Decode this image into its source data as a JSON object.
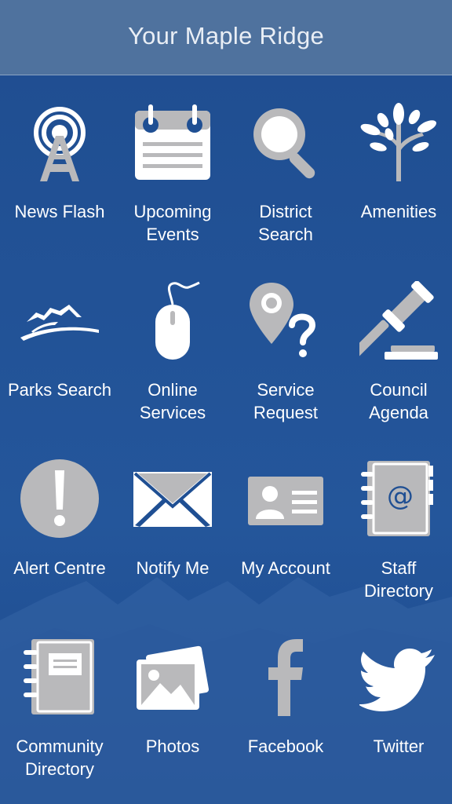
{
  "header": {
    "title": "Your Maple Ridge"
  },
  "tiles": [
    {
      "label": "News Flash"
    },
    {
      "label": "Upcoming\nEvents"
    },
    {
      "label": "District\nSearch"
    },
    {
      "label": "Amenities"
    },
    {
      "label": "Parks Search"
    },
    {
      "label": "Online\nServices"
    },
    {
      "label": "Service\nRequest"
    },
    {
      "label": "Council\nAgenda"
    },
    {
      "label": "Alert Centre"
    },
    {
      "label": "Notify Me"
    },
    {
      "label": "My Account"
    },
    {
      "label": "Staff\nDirectory"
    },
    {
      "label": "Community\nDirectory"
    },
    {
      "label": "Photos"
    },
    {
      "label": "Facebook"
    },
    {
      "label": "Twitter"
    }
  ],
  "colors": {
    "background": "#1f4f93",
    "header": "#4f729e",
    "icon": "#b9b9bb",
    "text": "#ffffff"
  }
}
